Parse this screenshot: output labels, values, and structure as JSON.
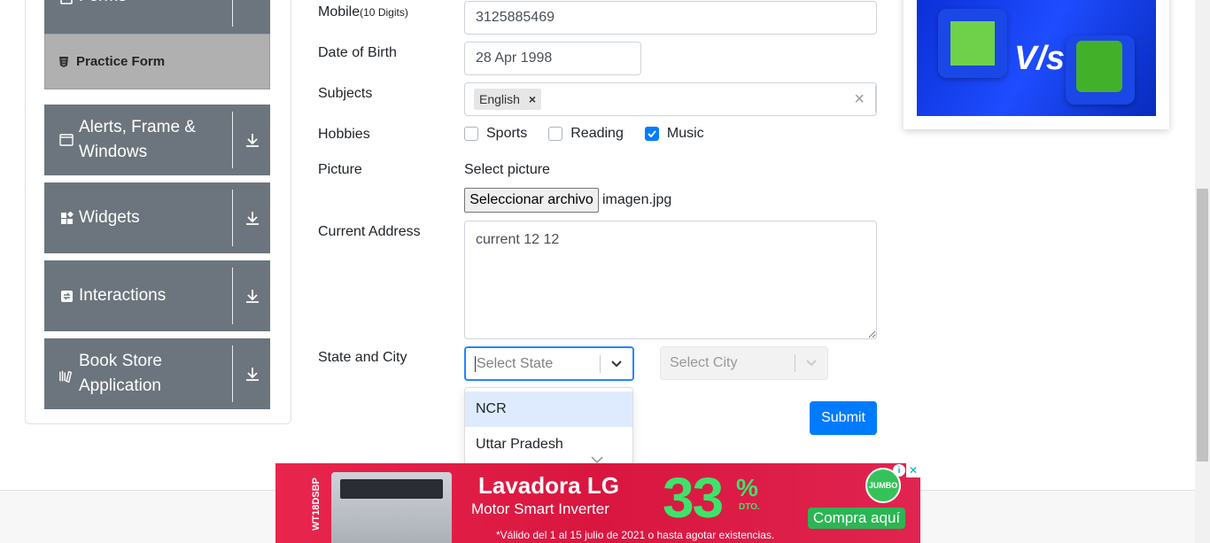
{
  "sidebar": {
    "groups": [
      {
        "label": "Forms",
        "icon": "forms-icon"
      },
      {
        "label": "Alerts, Frame & Windows",
        "icon": "window-icon"
      },
      {
        "label": "Widgets",
        "icon": "widgets-icon"
      },
      {
        "label": "Interactions",
        "icon": "interactions-icon"
      },
      {
        "label": "Book Store Application",
        "icon": "books-icon"
      }
    ],
    "active_item": "Practice Form"
  },
  "form": {
    "mobile_label": "Mobile",
    "mobile_hint": "(10 Digits)",
    "mobile_value": "3125885469",
    "dob_label": "Date of Birth",
    "dob_value": "28 Apr 1998",
    "subjects_label": "Subjects",
    "subject_chip": "English",
    "chip_remove": "×",
    "clear_all": "×",
    "hobbies_label": "Hobbies",
    "hobbies": [
      {
        "label": "Sports",
        "checked": false
      },
      {
        "label": "Reading",
        "checked": false
      },
      {
        "label": "Music",
        "checked": true
      }
    ],
    "picture_label": "Picture",
    "select_picture": "Select picture",
    "file_button": "Seleccionar archivo",
    "file_name": "imagen.jpg",
    "address_label": "Current Address",
    "address_value": "current 12 12",
    "state_city_label": "State and City",
    "state_placeholder": "Select State",
    "city_placeholder": "Select City",
    "state_options": [
      "NCR",
      "Uttar Pradesh"
    ],
    "submit_label": "Submit"
  },
  "ad_right": {
    "vs_text": "V/s"
  },
  "ad_bottom": {
    "model": "WT18DSBP",
    "title": "Lavadora LG",
    "subtitle": "Motor Smart Inverter",
    "percent": "33",
    "percent_sign": "%",
    "dto": "DTO.",
    "logo": "JUMBO",
    "cta": "Compra aquí",
    "disclaimer": "*Válido del 1 al 15 julio de 2021 o hasta agotar existencias.",
    "close": "✕",
    "info": "i"
  }
}
